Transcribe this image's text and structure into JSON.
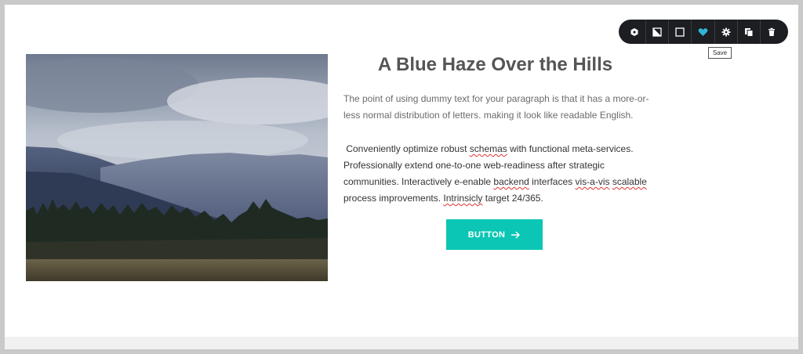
{
  "section": {
    "heading": "A Blue Haze Over the Hills",
    "paragraph1": "The point of using dummy text for your paragraph is that it has a more-or-less normal distribution of letters. making it look like readable English.",
    "paragraph2": {
      "t1": " Conveniently optimize robust ",
      "w1": "schemas",
      "t2": " with functional meta-services. Professionally extend one-to-one web-readiness after strategic communities. Interactively e-enable ",
      "w2": "backend",
      "t3": " interfaces ",
      "w3": "vis-a-vis",
      "t4": " ",
      "w4": "scalable",
      "t5": " process improvements. ",
      "w5": "Intrinsicly",
      "t6": " target 24/365."
    },
    "button_label": "BUTTON",
    "button_icon": "arrow-right-icon",
    "image": {
      "description_icon": "landscape-photo",
      "colors": {
        "sky": "#9aa6b8",
        "mountain": "#3d4a66",
        "forest": "#1f2a22",
        "meadow": "#5a5340"
      }
    }
  },
  "toolbar": {
    "items": [
      {
        "icon": "hexagon-icon",
        "label": ""
      },
      {
        "icon": "contrast-icon",
        "label": ""
      },
      {
        "icon": "square-icon",
        "label": ""
      },
      {
        "icon": "heart-icon",
        "label": ""
      },
      {
        "icon": "gear-icon",
        "label": ""
      },
      {
        "icon": "duplicate-icon",
        "label": ""
      },
      {
        "icon": "trash-icon",
        "label": ""
      }
    ],
    "active_color": "#2fb6d6",
    "tooltip": "Save"
  },
  "colors": {
    "accent": "#0bc6b4",
    "toolbar_bg": "#1c1e22",
    "frame_border": "#c9c9c9"
  }
}
